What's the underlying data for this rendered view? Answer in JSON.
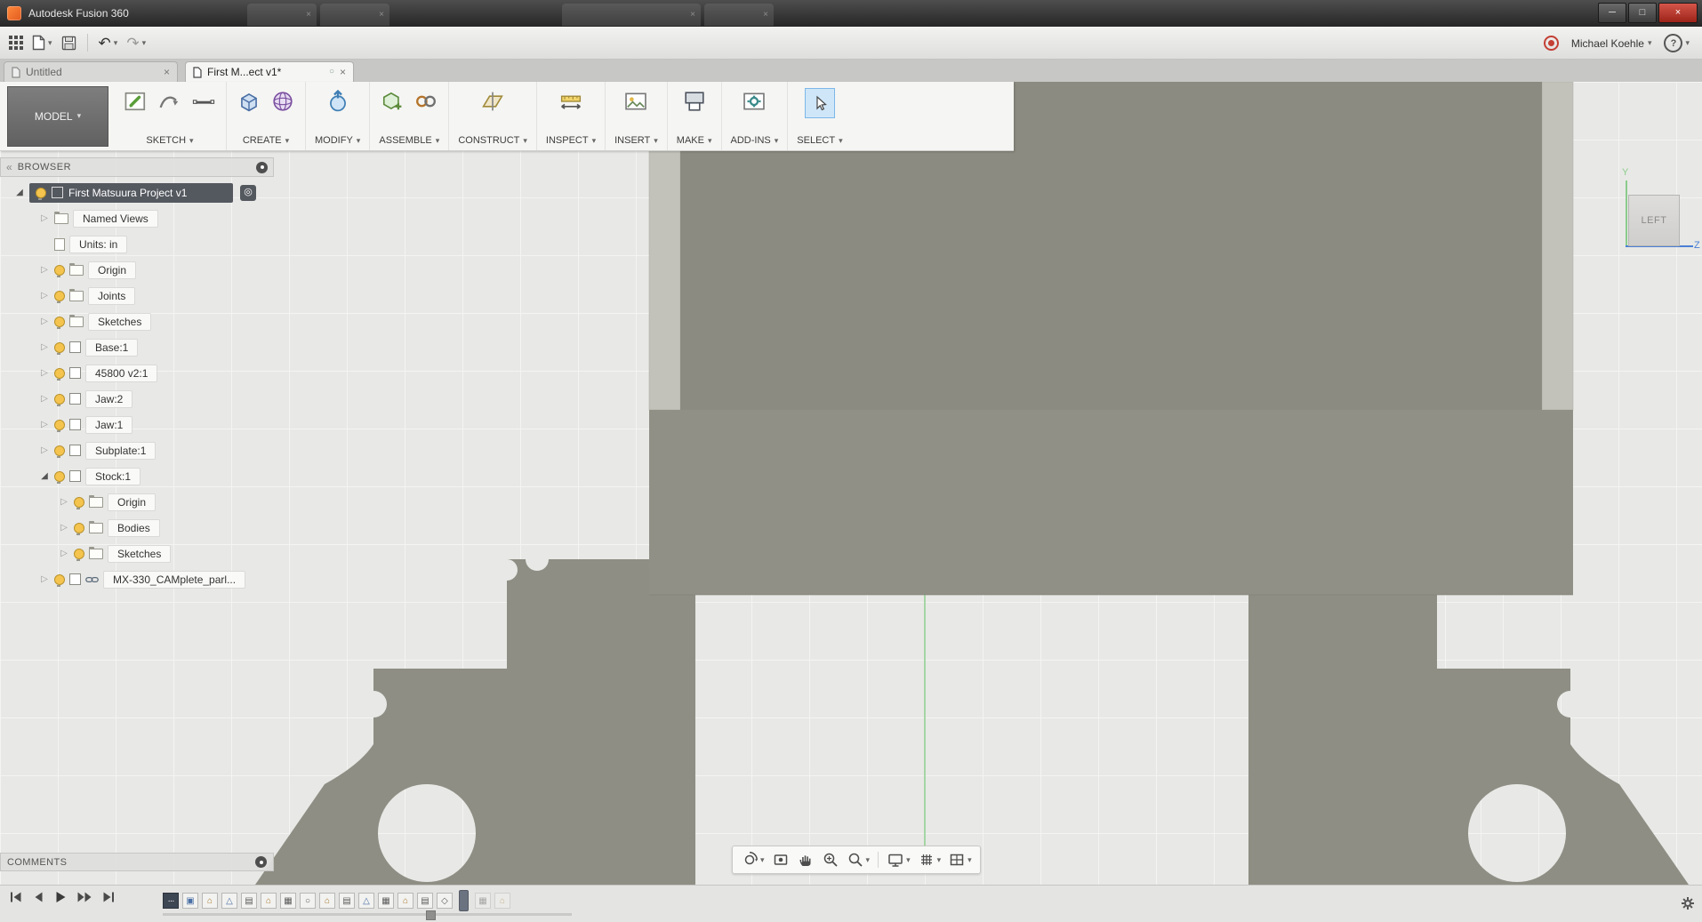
{
  "titlebar": {
    "title": "Autodesk Fusion 360"
  },
  "window_controls": {
    "minimize": "─",
    "maximize": "□",
    "close": "×"
  },
  "qat": {
    "user": "Michael Koehle",
    "help": "?"
  },
  "tabs": {
    "untitled": {
      "label": "Untitled",
      "close": "×"
    },
    "active": {
      "label": "First M...ect v1*",
      "close": "×",
      "status_dot": "○"
    }
  },
  "ribbon": {
    "model": "MODEL",
    "groups": [
      "SKETCH",
      "CREATE",
      "MODIFY",
      "ASSEMBLE",
      "CONSTRUCT",
      "INSPECT",
      "INSERT",
      "MAKE",
      "ADD-INS",
      "SELECT"
    ]
  },
  "browser": {
    "header": "BROWSER",
    "collapse_glyph": "«",
    "root": "First Matsuura Project v1",
    "items": [
      "Named Views",
      "Units: in",
      "Origin",
      "Joints",
      "Sketches",
      "Base:1",
      "45800 v2:1",
      "Jaw:2",
      "Jaw:1",
      "Subplate:1",
      "Stock:1",
      "Origin",
      "Bodies",
      "Sketches",
      "MX-330_CAMplete_parl..."
    ]
  },
  "viewcube": {
    "face": "LEFT",
    "axis_y": "Y",
    "axis_z": "Z"
  },
  "comments": {
    "header": "COMMENTS"
  },
  "icons": {
    "caret": "▾",
    "collapsed": "▷",
    "expanded": "◢",
    "undo": "↶",
    "redo": "↷"
  },
  "timeline": {
    "features": [
      "···",
      "▣",
      "⌂",
      "△",
      "▤",
      "⌂",
      "▦",
      "○",
      "⌂",
      "▤",
      "△",
      "▦",
      "⌂",
      "▤",
      "◇",
      "▦",
      "⌂"
    ]
  },
  "colors": {
    "select_highlight": "#cfe6f8",
    "model_gray": "#8e8e84",
    "stock_gray": "#909086",
    "panel_gray": "#8b8b81",
    "panel_light": "#c2c2ba",
    "axis_green": "#8ccc8c",
    "axis_blue": "#4a7fd4",
    "bulb_yellow": "#f4c44e",
    "record_red": "#c43f34"
  }
}
